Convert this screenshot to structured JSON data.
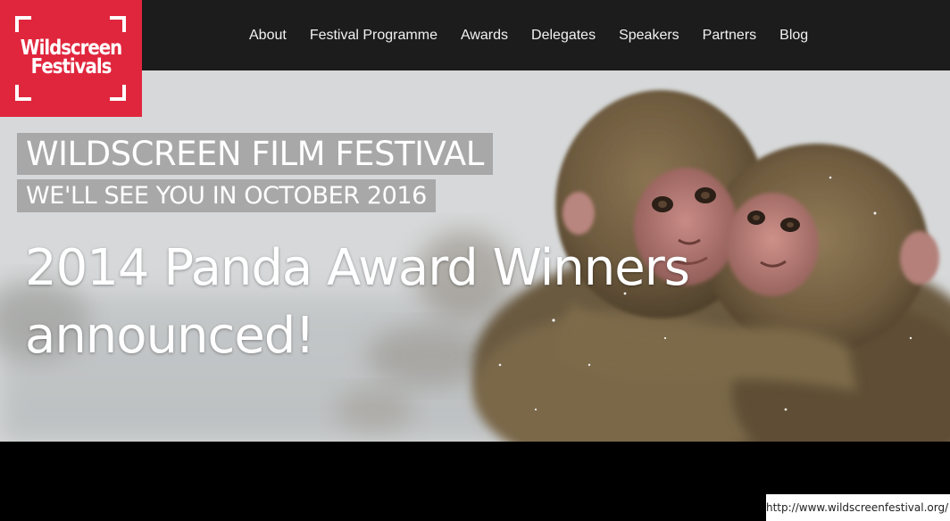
{
  "logo": {
    "line1": "Wildscreen",
    "line2": "Festivals"
  },
  "nav": {
    "items": [
      {
        "label": "About"
      },
      {
        "label": "Festival Programme"
      },
      {
        "label": "Awards"
      },
      {
        "label": "Delegates"
      },
      {
        "label": "Speakers"
      },
      {
        "label": "Partners"
      },
      {
        "label": "Blog"
      }
    ]
  },
  "hero": {
    "title": "WILDSCREEN FILM FESTIVAL",
    "subtitle": "WE'LL SEE YOU IN OCTOBER 2016",
    "headline": "2014 Panda Award Winners announced!",
    "image": "snow-monkeys-hugging"
  },
  "footer": {
    "url": "http://www.wildscreenfestival.org/"
  },
  "colors": {
    "brand_red": "#e0263d",
    "header_bg": "#1c1c1c",
    "text_white": "#ffffff"
  }
}
